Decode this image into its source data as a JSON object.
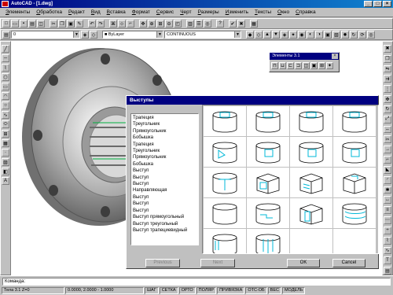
{
  "window": {
    "title": "AutoCAD - [1.dwg]"
  },
  "menubar": [
    "Элементы",
    "Обработка",
    "Редакт",
    "Вид",
    "Вставка",
    "Формат",
    "Сервис",
    "Черт",
    "Размеры",
    "Изменить",
    "Тексты",
    "Окно",
    "Справка"
  ],
  "toolbar2": {
    "layer": "0",
    "linetype": "CONTINUOUS"
  },
  "elements_panel": {
    "title": "Элементы 3.1"
  },
  "dialog": {
    "title": "Выступы",
    "list": [
      "Трапеция",
      "Треугольник",
      "Прямоугольник",
      "Бобышка",
      "Трапеция",
      "Треугольник",
      "Прямоугольник",
      "Бобышка",
      "Выступ",
      "Выступ",
      "Выступ",
      "Направляющая",
      "Выступ",
      "Выступ",
      "Выступ",
      "Выступ прямоугольный",
      "Выступ треугольный",
      "Выступ трапециевидный"
    ],
    "buttons": {
      "prev": "Previous",
      "next": "Next",
      "ok": "OK",
      "cancel": "Cancel"
    }
  },
  "command_line": {
    "prompt": "Команда:"
  },
  "statusbar": {
    "coords": "Тела 3.1  Z=0",
    "scale": "0.0000, 2.0000 - 1.0000",
    "modes": [
      "ШАГ",
      "СЕТКА",
      "ОРТО",
      "ПОЛЯР",
      "ПРИВЯЗКА",
      "ОТС-ОБ",
      "ВЕС",
      "МОДЕЛЬ"
    ]
  },
  "colors": {
    "title_bg": "#000080",
    "accent_cyan": "#00b8d8"
  }
}
